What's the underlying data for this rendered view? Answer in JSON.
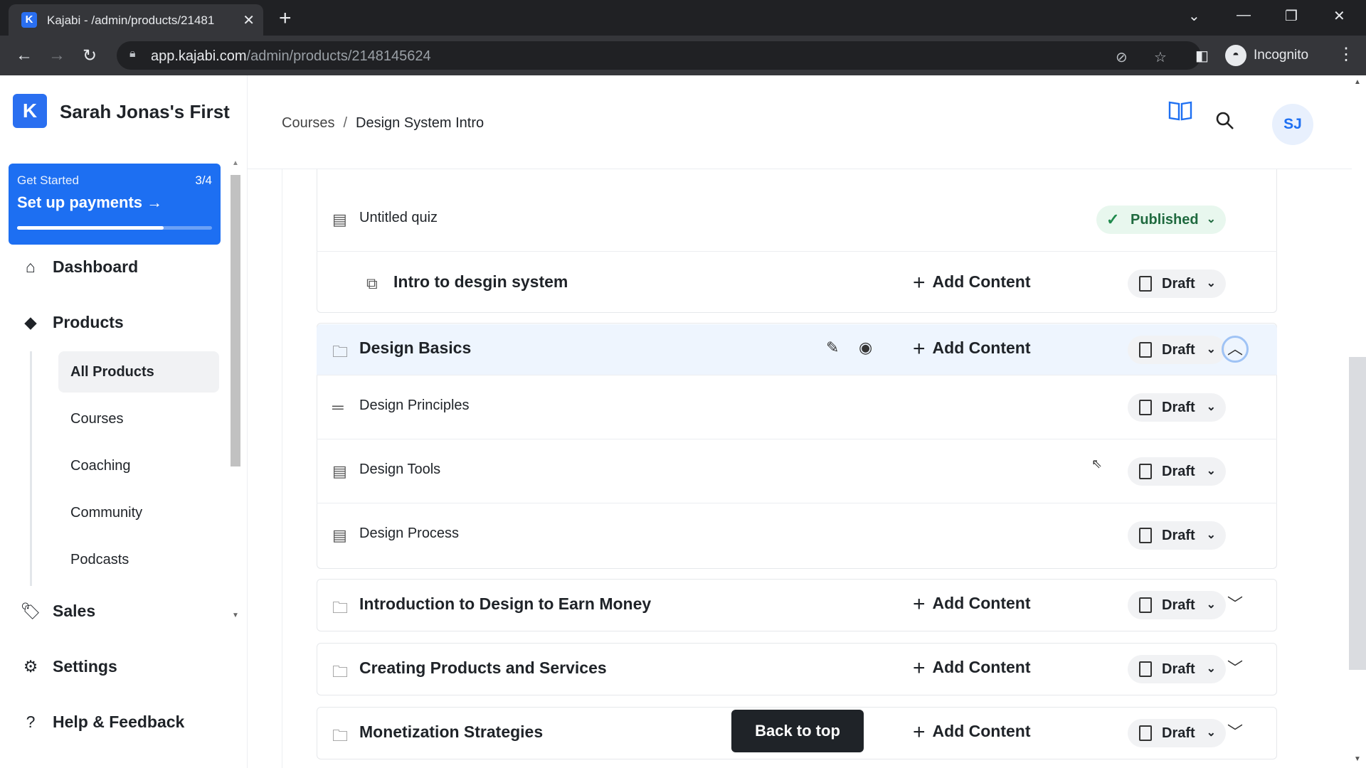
{
  "browser": {
    "tab_title": "Kajabi - /admin/products/21481",
    "tab_favicon": "K",
    "url_domain": "app.kajabi.com",
    "url_path": "/admin/products/2148145624",
    "profile_label": "Incognito"
  },
  "sidebar": {
    "brand_name": "Sarah Jonas's First",
    "get_started": {
      "kicker": "Get Started",
      "count": "3/4",
      "title": "Set up payments",
      "progress": 0.75
    },
    "nav": [
      {
        "label": "Dashboard",
        "icon": "home-icon"
      },
      {
        "label": "Products",
        "icon": "box-icon"
      },
      {
        "label": "Sales",
        "icon": "tag-icon"
      },
      {
        "label": "Settings",
        "icon": "gear-icon"
      },
      {
        "label": "Help & Feedback",
        "icon": "help-icon"
      }
    ],
    "products_sub": [
      "All Products",
      "Courses",
      "Coaching",
      "Community",
      "Podcasts"
    ]
  },
  "header": {
    "breadcrumb_root": "Courses",
    "breadcrumb_sep": "/",
    "breadcrumb_current": "Design System Intro",
    "avatar_initials": "SJ"
  },
  "rows": {
    "quiz": {
      "label": "Untitled quiz",
      "status": "Published"
    },
    "intro": {
      "label": "Intro to desgin system",
      "add": "Add Content",
      "status": "Draft"
    },
    "basics": {
      "label": "Design Basics",
      "add": "Add Content",
      "status": "Draft"
    },
    "principles": {
      "label": "Design Principles",
      "status": "Draft"
    },
    "tools": {
      "label": "Design Tools",
      "status": "Draft"
    },
    "process": {
      "label": "Design Process",
      "status": "Draft"
    },
    "earn": {
      "label": "Introduction to Design to Earn Money",
      "add": "Add Content",
      "status": "Draft"
    },
    "creating": {
      "label": "Creating Products and Services",
      "add": "Add Content",
      "status": "Draft"
    },
    "monet": {
      "label": "Monetization Strategies",
      "add": "Add Content",
      "status": "Draft"
    }
  },
  "back_to_top": "Back to top",
  "colors": {
    "accent": "#1d6ff2",
    "highlight": "#eef5fe",
    "published": "#e8f7ee"
  }
}
